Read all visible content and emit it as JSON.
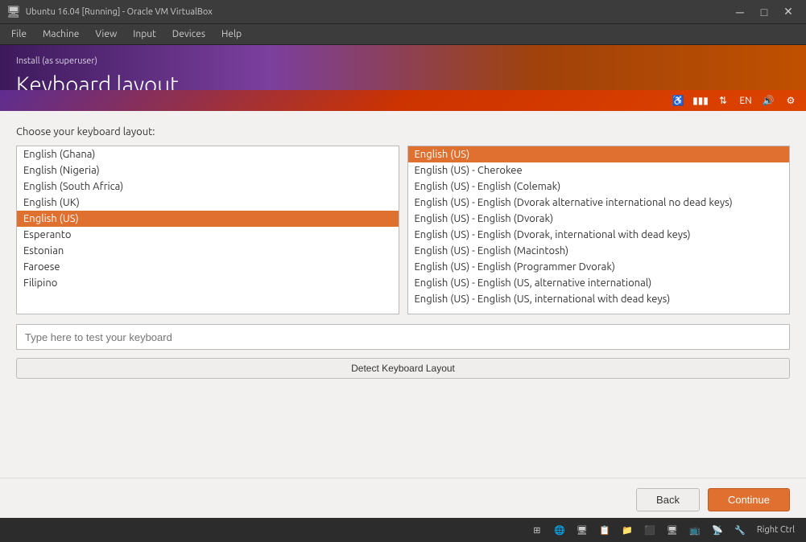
{
  "titlebar": {
    "title": "Ubuntu 16.04 [Running] - Oracle VM VirtualBox",
    "icon": "🖥",
    "minimize": "─",
    "maximize": "□",
    "close": "✕"
  },
  "menubar": {
    "items": [
      "File",
      "Machine",
      "View",
      "Input",
      "Devices",
      "Help"
    ]
  },
  "tray": {
    "icons": [
      "♿",
      "🔋",
      "⇅",
      "EN",
      "🔊",
      "⚙"
    ]
  },
  "installer": {
    "superuser_label": "Install (as superuser)",
    "page_title": "Keyboard layout",
    "choose_label": "Choose your keyboard layout:",
    "layout_items": [
      "English (Ghana)",
      "English (Nigeria)",
      "English (South Africa)",
      "English (UK)",
      "English (US)",
      "Esperanto",
      "Estonian",
      "Faroese",
      "Filipino"
    ],
    "selected_layout": "English (US)",
    "variant_items": [
      "English (US)",
      "English (US) - Cherokee",
      "English (US) - English (Colemak)",
      "English (US) - English (Dvorak alternative international no dead keys)",
      "English (US) - English (Dvorak)",
      "English (US) - English (Dvorak, international with dead keys)",
      "English (US) - English (Macintosh)",
      "English (US) - English (Programmer Dvorak)",
      "English (US) - English (US, alternative international)",
      "English (US) - English (US, international with dead keys)"
    ],
    "selected_variant": "English (US)",
    "test_placeholder": "Type here to test your keyboard",
    "detect_label": "Detect Keyboard Layout",
    "back_label": "Back",
    "continue_label": "Continue"
  },
  "progress": {
    "dots": [
      {
        "active": true
      },
      {
        "active": true
      },
      {
        "active": true
      },
      {
        "active": true
      },
      {
        "active": true
      },
      {
        "active": true
      },
      {
        "active": true
      },
      {
        "active": false
      }
    ]
  },
  "taskbar": {
    "right_ctrl_label": "Right Ctrl"
  }
}
